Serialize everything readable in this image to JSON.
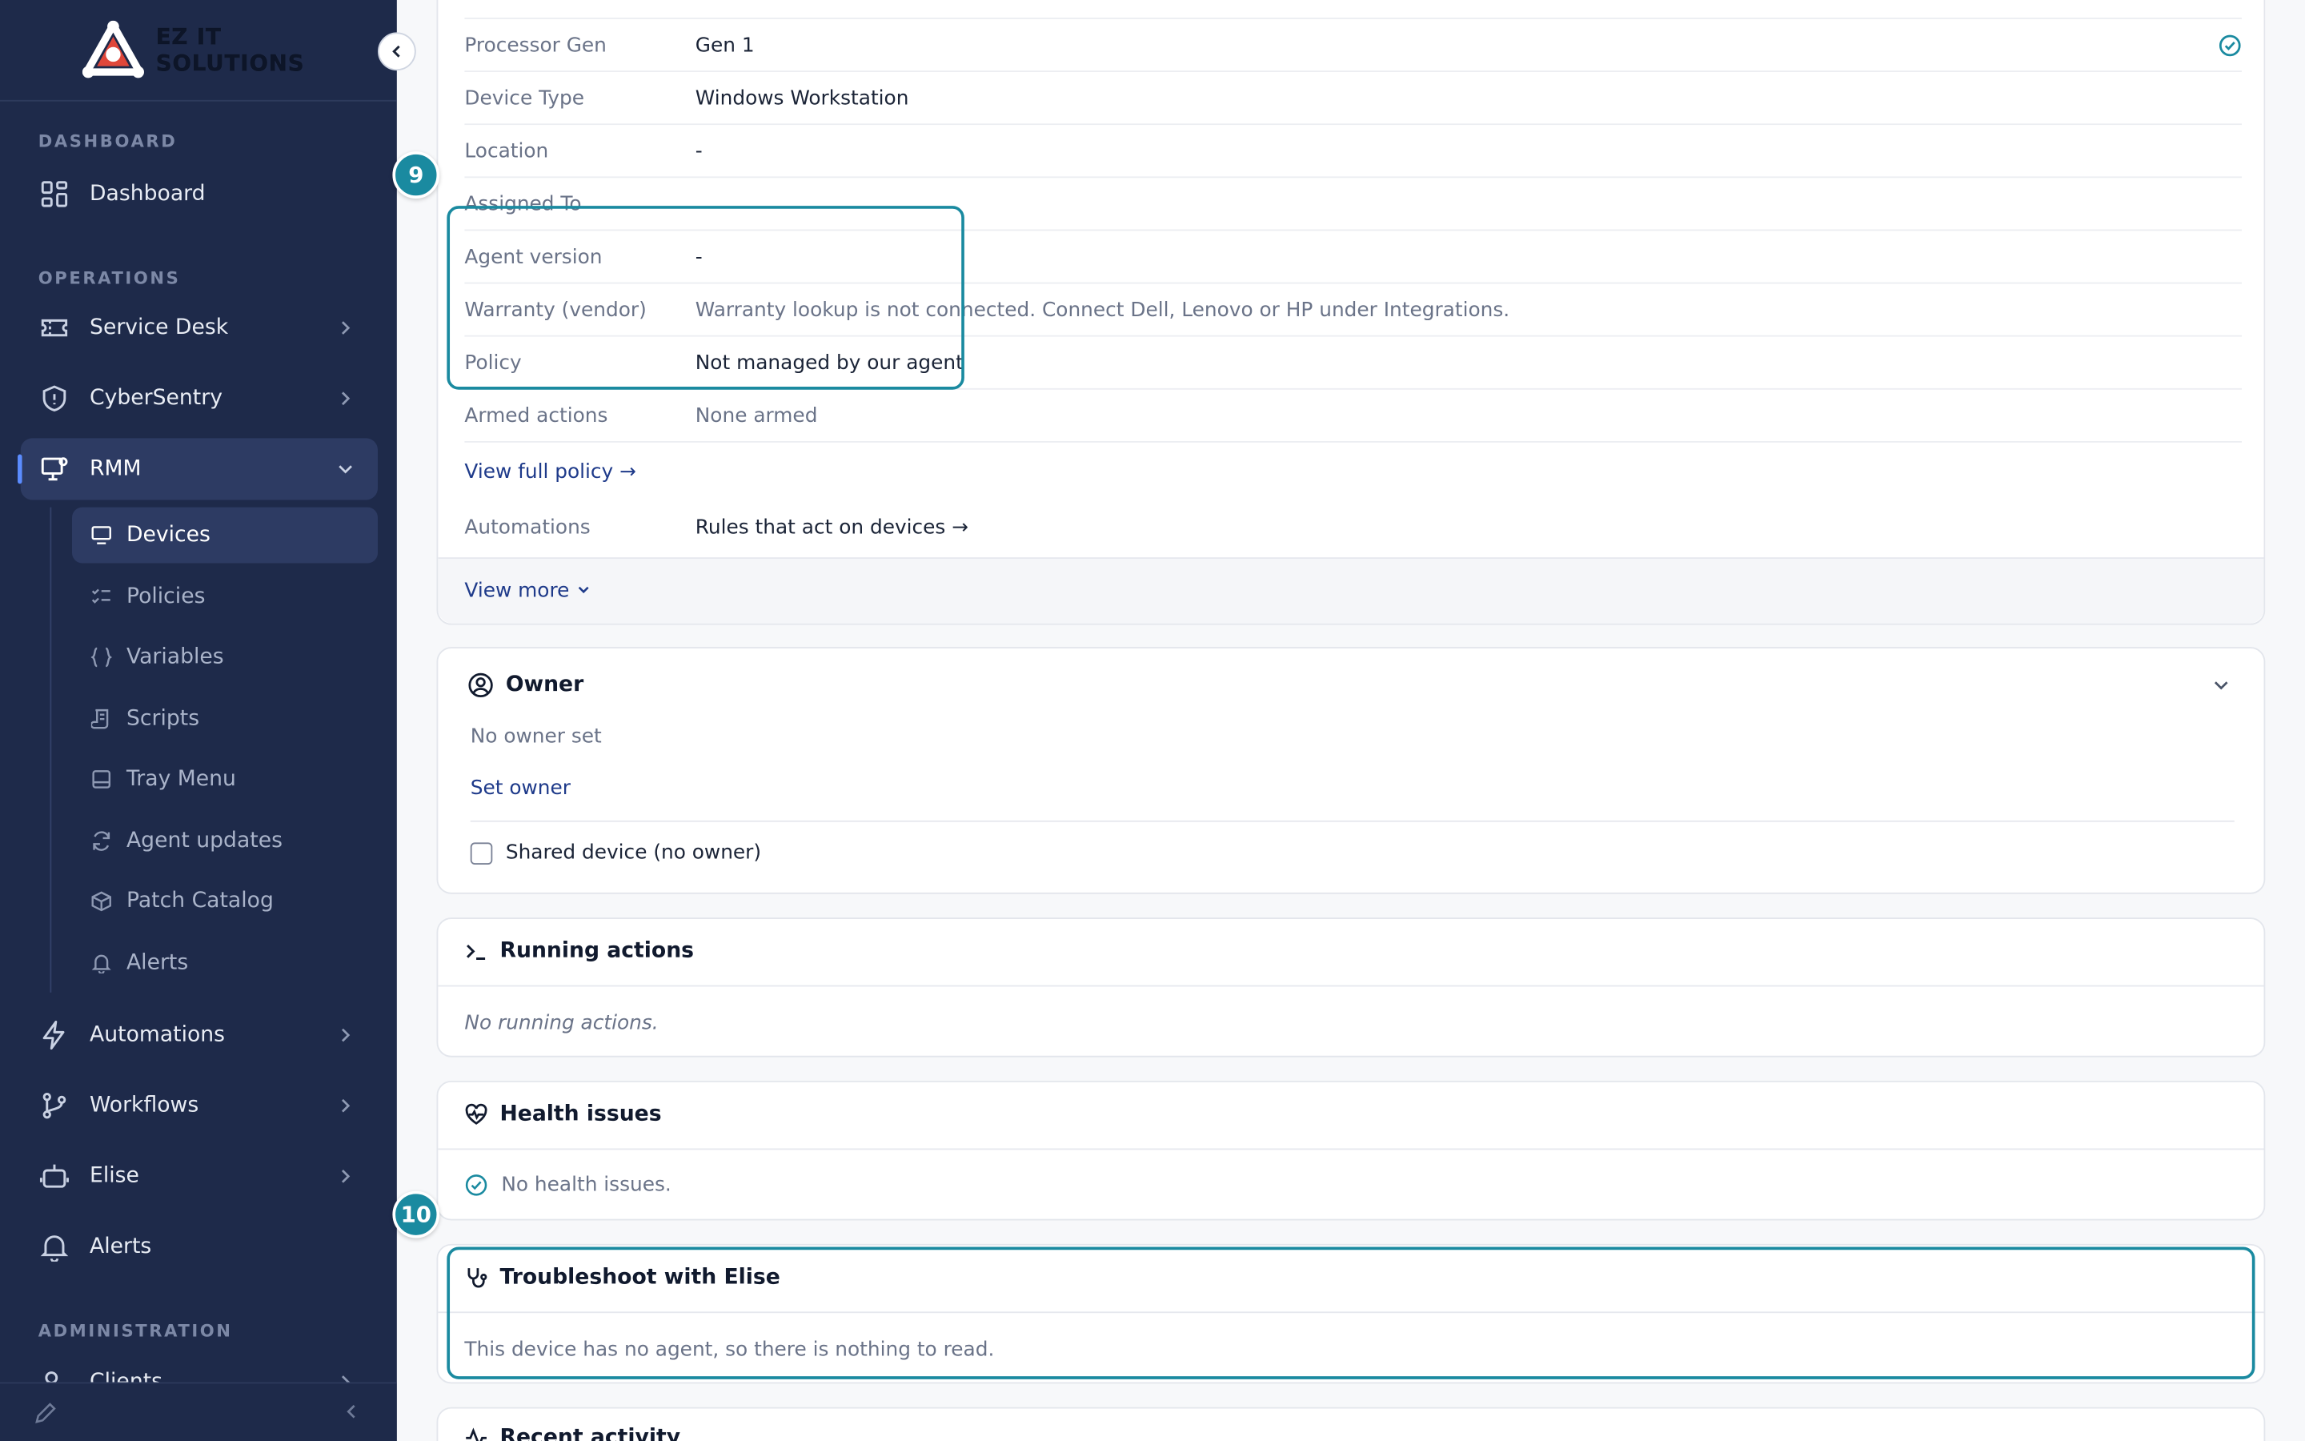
{
  "brand": {
    "line1": "EZ IT",
    "line2": "SOLUTIONS"
  },
  "sidebar": {
    "sections": {
      "dashboard": "DASHBOARD",
      "operations": "OPERATIONS",
      "administration": "ADMINISTRATION"
    },
    "items": {
      "dashboard": "Dashboard",
      "service_desk": "Service Desk",
      "cybersentry": "CyberSentry",
      "rmm": "RMM",
      "automations": "Automations",
      "workflows": "Workflows",
      "elise": "Elise",
      "alerts": "Alerts",
      "clients": "Clients"
    },
    "rmm_sub": {
      "devices": "Devices",
      "policies": "Policies",
      "variables": "Variables",
      "scripts": "Scripts",
      "tray_menu": "Tray Menu",
      "agent_updates": "Agent updates",
      "patch_catalog": "Patch Catalog",
      "alerts": "Alerts"
    }
  },
  "details": {
    "processor_gen": {
      "label": "Processor Gen",
      "value": "Gen 1"
    },
    "device_type": {
      "label": "Device Type",
      "value": "Windows Workstation"
    },
    "location": {
      "label": "Location",
      "value": "-"
    },
    "assigned_to": {
      "label": "Assigned To",
      "value": ""
    },
    "agent_version": {
      "label": "Agent version",
      "value": "-"
    },
    "warranty": {
      "label": "Warranty (vendor)",
      "value": "Warranty lookup is not connected. Connect Dell, Lenovo or HP under Integrations."
    },
    "policy": {
      "label": "Policy",
      "value": "Not managed by our agent"
    },
    "armed_actions": {
      "label": "Armed actions",
      "value": "None armed"
    },
    "view_full_policy": "View full policy",
    "automations": {
      "label": "Automations",
      "value": "Rules that act on devices"
    },
    "view_more": "View more"
  },
  "owner": {
    "title": "Owner",
    "status": "No owner set",
    "set_owner": "Set owner",
    "shared_device": "Shared device (no owner)"
  },
  "running_actions": {
    "title": "Running actions",
    "empty": "No running actions."
  },
  "health_issues": {
    "title": "Health issues",
    "empty": "No health issues."
  },
  "troubleshoot": {
    "title": "Troubleshoot with Elise",
    "body": "This device has no agent, so there is nothing to read."
  },
  "recent_activity": {
    "title": "Recent activity"
  },
  "callouts": {
    "first": "9",
    "second": "10"
  },
  "colors": {
    "sidebar_bg": "#1e2a4a",
    "highlight": "#1a8aa0",
    "link": "#1e3a8a",
    "accent_check": "#1a8aa0"
  }
}
